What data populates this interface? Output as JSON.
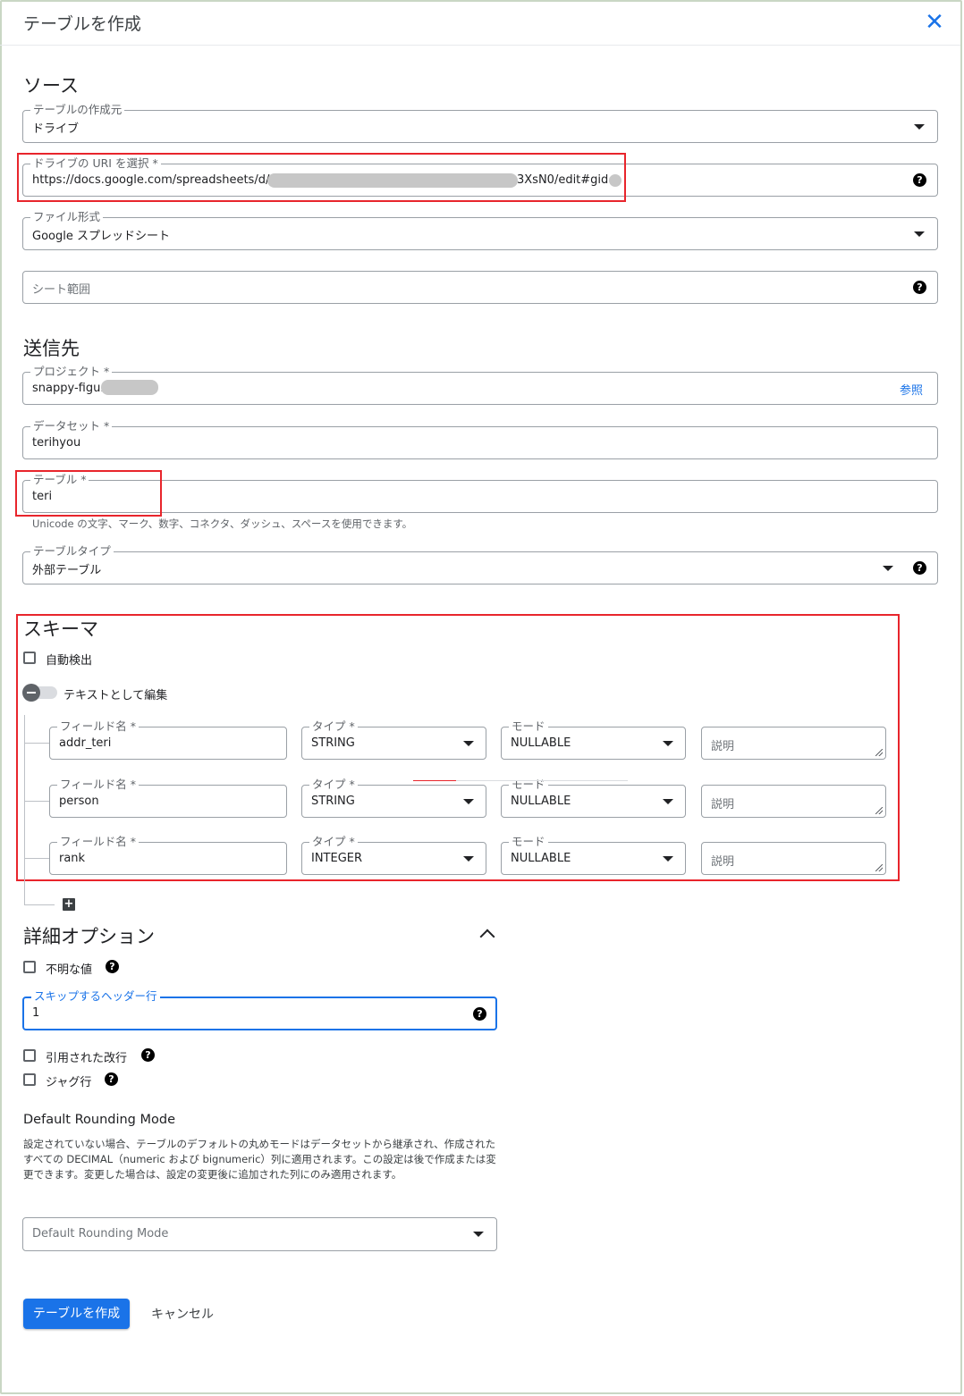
{
  "header": {
    "title": "テーブルを作成"
  },
  "source": {
    "section_title": "ソース",
    "create_from": {
      "label": "テーブルの作成元",
      "value": "ドライブ"
    },
    "drive_uri": {
      "label": "ドライブの URI を選択 *",
      "value_start": "https://docs.google.com/spreadsheets/d/14",
      "value_end": "3XsN0/edit#gid="
    },
    "file_format": {
      "label": "ファイル形式",
      "value": "Google スプレッドシート"
    },
    "sheet_range": {
      "placeholder": "シート範囲"
    }
  },
  "destination": {
    "section_title": "送信先",
    "project": {
      "label": "プロジェクト *",
      "value": "snappy-figure",
      "browse": "参照"
    },
    "dataset": {
      "label": "データセット *",
      "value": "terihyou"
    },
    "table": {
      "label": "テーブル *",
      "value": "teri",
      "hint": "Unicode の文字、マーク、数字、コネクタ、ダッシュ、スペースを使用できます。"
    },
    "table_type": {
      "label": "テーブルタイプ",
      "value": "外部テーブル"
    }
  },
  "schema": {
    "section_title": "スキーマ",
    "auto_detect": "自動検出",
    "edit_as_text": "テキストとして編集",
    "rows": [
      {
        "field_label": "フィールド名 *",
        "field": "addr_teri",
        "type_label": "タイプ *",
        "type": "STRING",
        "mode_label": "モード",
        "mode": "NULLABLE",
        "desc": "説明"
      },
      {
        "field_label": "フィールド名 *",
        "field": "person",
        "type_label": "タイプ *",
        "type": "STRING",
        "mode_label": "モード",
        "mode": "NULLABLE",
        "desc": "説明"
      },
      {
        "field_label": "フィールド名 *",
        "field": "rank",
        "type_label": "タイプ *",
        "type": "INTEGER",
        "mode_label": "モード",
        "mode": "NULLABLE",
        "desc": "説明"
      }
    ]
  },
  "advanced": {
    "section_title": "詳細オプション",
    "unknown_values": "不明な値",
    "skip_header": {
      "label": "スキップするヘッダー行",
      "value": "1"
    },
    "quoted_newlines": "引用された改行",
    "jagged_rows": "ジャグ行",
    "rounding": {
      "title": "Default Rounding Mode",
      "description": "設定されていない場合、テーブルのデフォルトの丸めモードはデータセットから継承され、作成されたすべての DECIMAL（numeric および bignumeric）列に適用されます。この設定は後で作成または変更できます。変更した場合は、設定の変更後に追加された列にのみ適用されます。",
      "placeholder": "Default Rounding Mode"
    }
  },
  "actions": {
    "create": "テーブルを作成",
    "cancel": "キャンセル"
  },
  "colors": {
    "accent": "#1a73e8",
    "highlight": "#e8252c"
  },
  "icons": {
    "close": "close-icon",
    "help": "help-icon",
    "dropdown": "chevron-down-icon",
    "add": "add-icon",
    "collapse": "chevron-up-icon"
  }
}
